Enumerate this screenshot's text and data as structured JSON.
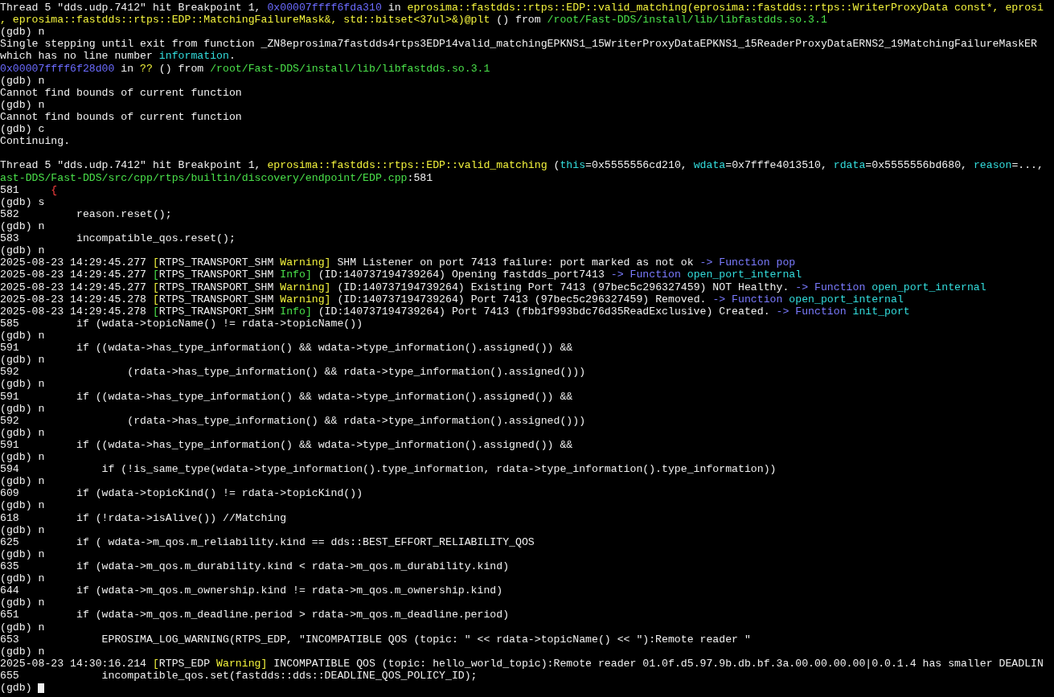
{
  "lines": [
    {
      "kind": "text",
      "segments": [
        {
          "text": "Thread 5 \"dds.udp.7412\" hit Breakpoint 1, ",
          "color": "#f0f0f0"
        },
        {
          "text": "0x00007ffff6fda310",
          "color": "#6b6bff"
        },
        {
          "text": " in ",
          "color": "#f0f0f0"
        },
        {
          "text": "eprosima::fastdds::rtps::EDP::valid_matching(eprosima::fastdds::rtps::WriterProxyData const*, eprosi",
          "color": "#f2f23c"
        }
      ]
    },
    {
      "kind": "text",
      "segments": [
        {
          "text": ", eprosima::fastdds::rtps::EDP::MatchingFailureMask&, std::bitset<37ul>&)@plt",
          "color": "#f2f23c"
        },
        {
          "text": " () from ",
          "color": "#f0f0f0"
        },
        {
          "text": "/root/Fast-DDS/install/lib/libfastdds.so.3.1",
          "color": "#4ae04a"
        }
      ]
    },
    {
      "kind": "text",
      "segments": [
        {
          "text": "(gdb) n",
          "color": "#f0f0f0"
        }
      ]
    },
    {
      "kind": "text",
      "segments": [
        {
          "text": "Single stepping until exit from function _ZN8eprosima7fastdds4rtps3EDP14valid_matchingEPKNS1_15WriterProxyDataEPKNS1_15ReaderProxyDataERNS2_19MatchingFailureMaskER",
          "color": "#f0f0f0"
        }
      ]
    },
    {
      "kind": "text",
      "segments": [
        {
          "text": "which has no line number ",
          "color": "#f0f0f0"
        },
        {
          "text": "information",
          "color": "#33dddd"
        },
        {
          "text": "."
        }
      ]
    },
    {
      "kind": "text",
      "segments": [
        {
          "text": "0x00007ffff6f28d00",
          "color": "#6b6bff"
        },
        {
          "text": " in ",
          "color": "#f0f0f0"
        },
        {
          "text": "??",
          "color": "#f2f23c"
        },
        {
          "text": " () from ",
          "color": "#f0f0f0"
        },
        {
          "text": "/root/Fast-DDS/install/lib/libfastdds.so.3.1",
          "color": "#4ae04a"
        }
      ]
    },
    {
      "kind": "text",
      "segments": [
        {
          "text": "(gdb) n",
          "color": "#f0f0f0"
        }
      ]
    },
    {
      "kind": "text",
      "segments": [
        {
          "text": "Cannot find bounds of current function",
          "color": "#f0f0f0"
        }
      ]
    },
    {
      "kind": "text",
      "segments": [
        {
          "text": "(gdb) n",
          "color": "#f0f0f0"
        }
      ]
    },
    {
      "kind": "text",
      "segments": [
        {
          "text": "Cannot find bounds of current function",
          "color": "#f0f0f0"
        }
      ]
    },
    {
      "kind": "text",
      "segments": [
        {
          "text": "(gdb) c",
          "color": "#f0f0f0"
        }
      ]
    },
    {
      "kind": "text",
      "segments": [
        {
          "text": "Continuing.",
          "color": "#f0f0f0"
        }
      ]
    },
    {
      "kind": "blank"
    },
    {
      "kind": "text",
      "segments": [
        {
          "text": "Thread 5 \"dds.udp.7412\" hit Breakpoint 1, ",
          "color": "#f0f0f0"
        },
        {
          "text": "eprosima::fastdds::rtps::EDP::valid_matching",
          "color": "#f2f23c"
        },
        {
          "text": " (",
          "color": "#f0f0f0"
        },
        {
          "text": "this",
          "color": "#33dddd"
        },
        {
          "text": "=0x5555556cd210, ",
          "color": "#f0f0f0"
        },
        {
          "text": "wdata",
          "color": "#33dddd"
        },
        {
          "text": "=0x7fffe4013510, ",
          "color": "#f0f0f0"
        },
        {
          "text": "rdata",
          "color": "#33dddd"
        },
        {
          "text": "=0x5555556bd680, ",
          "color": "#f0f0f0"
        },
        {
          "text": "reason",
          "color": "#33dddd"
        },
        {
          "text": "=...,",
          "color": "#f0f0f0"
        }
      ]
    },
    {
      "kind": "text",
      "segments": [
        {
          "text": "ast-DDS/Fast-DDS/src/cpp/rtps/builtin/discovery/endpoint/EDP.cpp",
          "color": "#4ae04a"
        },
        {
          "text": ":581",
          "color": "#f0f0f0"
        }
      ]
    },
    {
      "kind": "text",
      "segments": [
        {
          "text": "581     ",
          "color": "#f0f0f0"
        },
        {
          "text": "{",
          "color": "#ff4040"
        }
      ]
    },
    {
      "kind": "text",
      "segments": [
        {
          "text": "(gdb) s",
          "color": "#f0f0f0"
        }
      ]
    },
    {
      "kind": "text",
      "segments": [
        {
          "text": "582         reason.reset();",
          "color": "#f0f0f0"
        }
      ]
    },
    {
      "kind": "text",
      "segments": [
        {
          "text": "(gdb) n",
          "color": "#f0f0f0"
        }
      ]
    },
    {
      "kind": "text",
      "segments": [
        {
          "text": "583         incompatible_qos.reset();",
          "color": "#f0f0f0"
        }
      ]
    },
    {
      "kind": "text",
      "segments": [
        {
          "text": "(gdb) n",
          "color": "#f0f0f0"
        }
      ]
    },
    {
      "kind": "text",
      "segments": [
        {
          "text": "2025-08-23 14:29:45.277 ",
          "color": "#f0f0f0"
        },
        {
          "text": "[",
          "color": "#f2f23c"
        },
        {
          "text": "RTPS_TRANSPORT_SHM",
          "color": "#f0f0f0"
        },
        {
          "text": " Warning]",
          "color": "#f2f23c"
        },
        {
          "text": " SHM Listener on port 7413 failure: port marked as not ok ",
          "color": "#f0f0f0"
        },
        {
          "text": "-> Function pop",
          "color": "#7b7bff"
        }
      ]
    },
    {
      "kind": "text",
      "segments": [
        {
          "text": "2025-08-23 14:29:45.277 ",
          "color": "#f0f0f0"
        },
        {
          "text": "[",
          "color": "#4ae04a"
        },
        {
          "text": "RTPS_TRANSPORT_SHM",
          "color": "#f0f0f0"
        },
        {
          "text": " Info]",
          "color": "#4ae04a"
        },
        {
          "text": " (ID:140737194739264) Opening fastdds_port7413 ",
          "color": "#f0f0f0"
        },
        {
          "text": "-> Function ",
          "color": "#7b7bff"
        },
        {
          "text": "open_port_internal",
          "color": "#33dddd"
        }
      ]
    },
    {
      "kind": "text",
      "segments": [
        {
          "text": "2025-08-23 14:29:45.277 ",
          "color": "#f0f0f0"
        },
        {
          "text": "[",
          "color": "#f2f23c"
        },
        {
          "text": "RTPS_TRANSPORT_SHM",
          "color": "#f0f0f0"
        },
        {
          "text": " Warning]",
          "color": "#f2f23c"
        },
        {
          "text": " (ID:140737194739264) Existing Port 7413 (97bec5c296327459) NOT Healthy. ",
          "color": "#f0f0f0"
        },
        {
          "text": "-> Function ",
          "color": "#7b7bff"
        },
        {
          "text": "open_port_internal",
          "color": "#33dddd"
        }
      ]
    },
    {
      "kind": "text",
      "segments": [
        {
          "text": "2025-08-23 14:29:45.278 ",
          "color": "#f0f0f0"
        },
        {
          "text": "[",
          "color": "#f2f23c"
        },
        {
          "text": "RTPS_TRANSPORT_SHM",
          "color": "#f0f0f0"
        },
        {
          "text": " Warning]",
          "color": "#f2f23c"
        },
        {
          "text": " (ID:140737194739264) Port 7413 (97bec5c296327459) Removed. ",
          "color": "#f0f0f0"
        },
        {
          "text": "-> Function ",
          "color": "#7b7bff"
        },
        {
          "text": "open_port_internal",
          "color": "#33dddd"
        }
      ]
    },
    {
      "kind": "text",
      "segments": [
        {
          "text": "2025-08-23 14:29:45.278 ",
          "color": "#f0f0f0"
        },
        {
          "text": "[",
          "color": "#4ae04a"
        },
        {
          "text": "RTPS_TRANSPORT_SHM",
          "color": "#f0f0f0"
        },
        {
          "text": " Info]",
          "color": "#4ae04a"
        },
        {
          "text": " (ID:140737194739264) Port 7413 (fbb1f993bdc76d35ReadExclusive) Created. ",
          "color": "#f0f0f0"
        },
        {
          "text": "-> Function ",
          "color": "#7b7bff"
        },
        {
          "text": "init_port",
          "color": "#33dddd"
        }
      ]
    },
    {
      "kind": "text",
      "segments": [
        {
          "text": "585         if (wdata->topicName() != rdata->topicName())",
          "color": "#f0f0f0"
        }
      ]
    },
    {
      "kind": "text",
      "segments": [
        {
          "text": "(gdb) n",
          "color": "#f0f0f0"
        }
      ]
    },
    {
      "kind": "text",
      "segments": [
        {
          "text": "591         if ((wdata->has_type_information() && wdata->type_information().assigned()) &&",
          "color": "#f0f0f0"
        }
      ]
    },
    {
      "kind": "text",
      "segments": [
        {
          "text": "(gdb) n",
          "color": "#f0f0f0"
        }
      ]
    },
    {
      "kind": "text",
      "segments": [
        {
          "text": "592                 (rdata->has_type_information() && rdata->type_information().assigned()))",
          "color": "#f0f0f0"
        }
      ]
    },
    {
      "kind": "text",
      "segments": [
        {
          "text": "(gdb) n",
          "color": "#f0f0f0"
        }
      ]
    },
    {
      "kind": "text",
      "segments": [
        {
          "text": "591         if ((wdata->has_type_information() && wdata->type_information().assigned()) &&",
          "color": "#f0f0f0"
        }
      ]
    },
    {
      "kind": "text",
      "segments": [
        {
          "text": "(gdb) n",
          "color": "#f0f0f0"
        }
      ]
    },
    {
      "kind": "text",
      "segments": [
        {
          "text": "592                 (rdata->has_type_information() && rdata->type_information().assigned()))",
          "color": "#f0f0f0"
        }
      ]
    },
    {
      "kind": "text",
      "segments": [
        {
          "text": "(gdb) n",
          "color": "#f0f0f0"
        }
      ]
    },
    {
      "kind": "text",
      "segments": [
        {
          "text": "591         if ((wdata->has_type_information() && wdata->type_information().assigned()) &&",
          "color": "#f0f0f0"
        }
      ]
    },
    {
      "kind": "text",
      "segments": [
        {
          "text": "(gdb) n",
          "color": "#f0f0f0"
        }
      ]
    },
    {
      "kind": "text",
      "segments": [
        {
          "text": "594             if (!is_same_type(wdata->type_information().type_information, rdata->type_information().type_information))",
          "color": "#f0f0f0"
        }
      ]
    },
    {
      "kind": "text",
      "segments": [
        {
          "text": "(gdb) n",
          "color": "#f0f0f0"
        }
      ]
    },
    {
      "kind": "text",
      "segments": [
        {
          "text": "609         if (wdata->topicKind() != rdata->topicKind())",
          "color": "#f0f0f0"
        }
      ]
    },
    {
      "kind": "text",
      "segments": [
        {
          "text": "(gdb) n",
          "color": "#f0f0f0"
        }
      ]
    },
    {
      "kind": "text",
      "segments": [
        {
          "text": "618         if (!rdata->isAlive()) //Matching",
          "color": "#f0f0f0"
        }
      ]
    },
    {
      "kind": "text",
      "segments": [
        {
          "text": "(gdb) n",
          "color": "#f0f0f0"
        }
      ]
    },
    {
      "kind": "text",
      "segments": [
        {
          "text": "625         if ( wdata->m_qos.m_reliability.kind == dds::BEST_EFFORT_RELIABILITY_QOS",
          "color": "#f0f0f0"
        }
      ]
    },
    {
      "kind": "text",
      "segments": [
        {
          "text": "(gdb) n",
          "color": "#f0f0f0"
        }
      ]
    },
    {
      "kind": "text",
      "segments": [
        {
          "text": "635         if (wdata->m_qos.m_durability.kind < rdata->m_qos.m_durability.kind)",
          "color": "#f0f0f0"
        }
      ]
    },
    {
      "kind": "text",
      "segments": [
        {
          "text": "(gdb) n",
          "color": "#f0f0f0"
        }
      ]
    },
    {
      "kind": "text",
      "segments": [
        {
          "text": "644         if (wdata->m_qos.m_ownership.kind != rdata->m_qos.m_ownership.kind)",
          "color": "#f0f0f0"
        }
      ]
    },
    {
      "kind": "text",
      "segments": [
        {
          "text": "(gdb) n",
          "color": "#f0f0f0"
        }
      ]
    },
    {
      "kind": "text",
      "segments": [
        {
          "text": "651         if (wdata->m_qos.m_deadline.period > rdata->m_qos.m_deadline.period)",
          "color": "#f0f0f0"
        }
      ]
    },
    {
      "kind": "text",
      "segments": [
        {
          "text": "(gdb) n",
          "color": "#f0f0f0"
        }
      ]
    },
    {
      "kind": "text",
      "segments": [
        {
          "text": "653             EPROSIMA_LOG_WARNING(RTPS_EDP, \"INCOMPATIBLE QOS (topic: \" << rdata->topicName() << \"):Remote reader \"",
          "color": "#f0f0f0"
        }
      ]
    },
    {
      "kind": "text",
      "segments": [
        {
          "text": "(gdb) n",
          "color": "#f0f0f0"
        }
      ]
    },
    {
      "kind": "text",
      "segments": [
        {
          "text": "2025-08-23 14:30:16.214 ",
          "color": "#f0f0f0"
        },
        {
          "text": "[",
          "color": "#f2f23c"
        },
        {
          "text": "RTPS_EDP",
          "color": "#f0f0f0"
        },
        {
          "text": " Warning]",
          "color": "#f2f23c"
        },
        {
          "text": " INCOMPATIBLE QOS (topic: hello_world_topic):Remote reader 01.0f.d5.97.9b.db.bf.3a.00.00.00.00|0.0.1.4 has smaller DEADLIN",
          "color": "#f0f0f0"
        }
      ]
    },
    {
      "kind": "text",
      "segments": [
        {
          "text": "655             incompatible_qos.set(fastdds::dds::DEADLINE_QOS_POLICY_ID);",
          "color": "#f0f0f0"
        }
      ]
    },
    {
      "kind": "text",
      "cursor": true,
      "segments": [
        {
          "text": "(gdb) ",
          "color": "#f0f0f0"
        }
      ]
    }
  ]
}
